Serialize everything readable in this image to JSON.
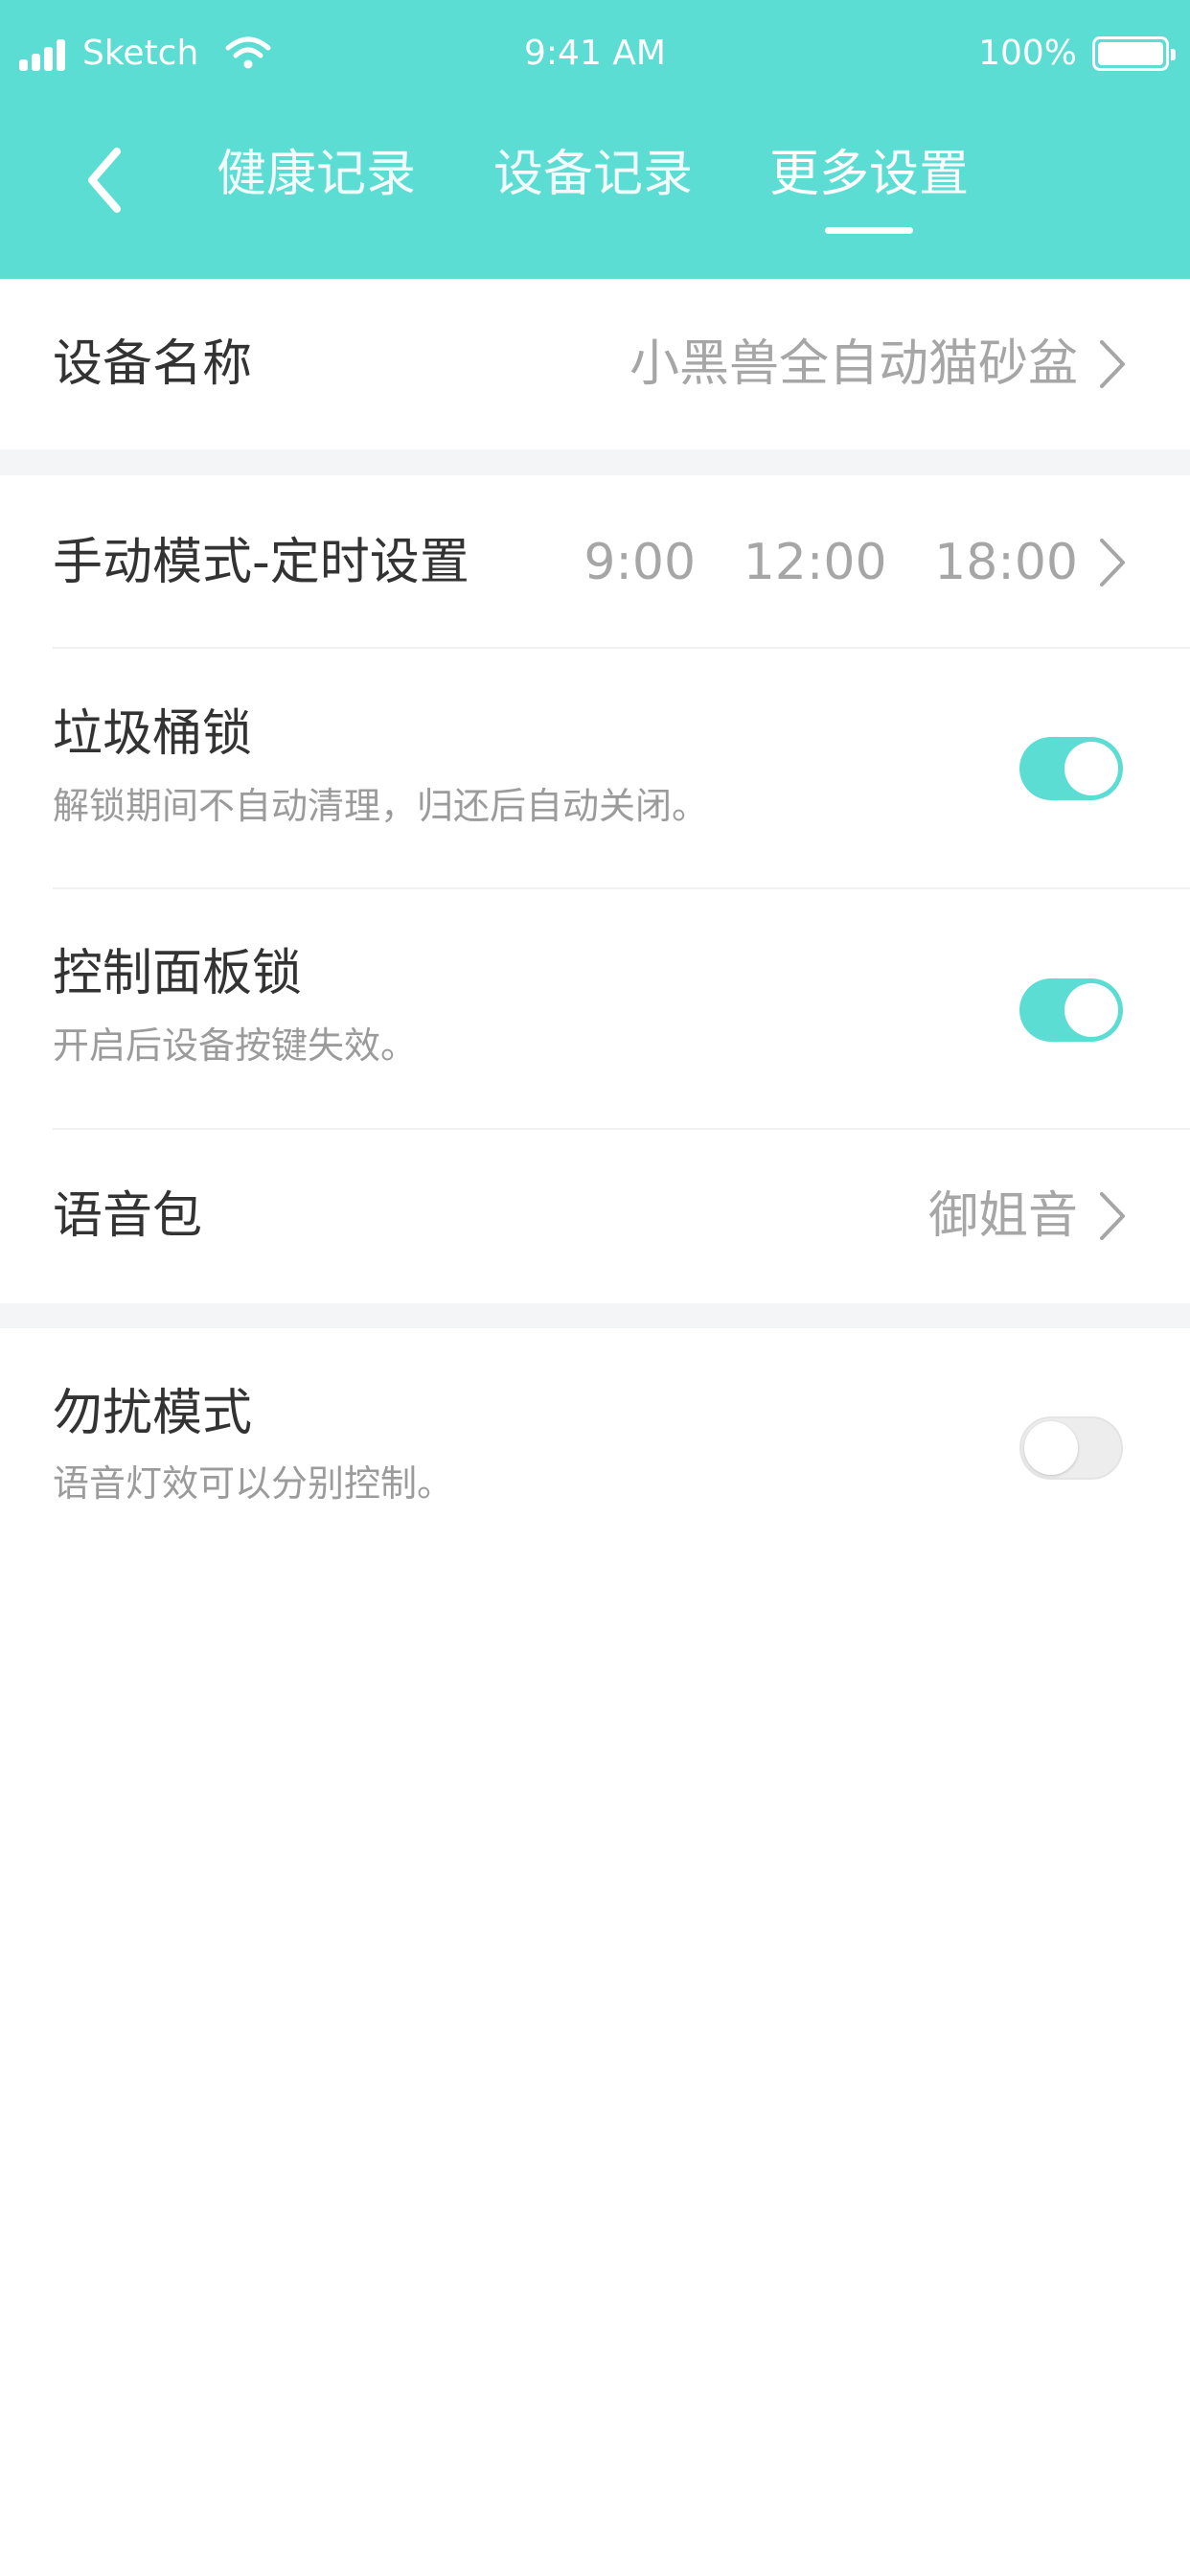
{
  "status_bar": {
    "carrier": "Sketch",
    "time": "9:41 AM",
    "battery": "100%"
  },
  "nav": {
    "back_icon": "chevron-left-icon",
    "tabs": [
      {
        "label": "健康记录",
        "active": false
      },
      {
        "label": "设备记录",
        "active": false
      },
      {
        "label": "更多设置",
        "active": true
      }
    ]
  },
  "settings": {
    "device_name": {
      "title": "设备名称",
      "value": "小黑兽全自动猫砂盆"
    },
    "manual_timer": {
      "title": "手动模式-定时设置",
      "value": "9:00   12:00   18:00"
    },
    "bin_lock": {
      "title": "垃圾桶锁",
      "subtitle": "解锁期间不自动清理，归还后自动关闭。",
      "enabled": true
    },
    "panel_lock": {
      "title": "控制面板锁",
      "subtitle": "开启后设备按键失效。",
      "enabled": true
    },
    "voice_pack": {
      "title": "语音包",
      "value": "御姐音"
    },
    "dnd": {
      "title": "勿扰模式",
      "subtitle": "语音灯效可以分别控制。",
      "enabled": false
    }
  },
  "colors": {
    "accent": "#5cddd3",
    "text_primary": "#333333",
    "text_secondary": "#9b9b9b",
    "separator": "#f4f5f7"
  }
}
